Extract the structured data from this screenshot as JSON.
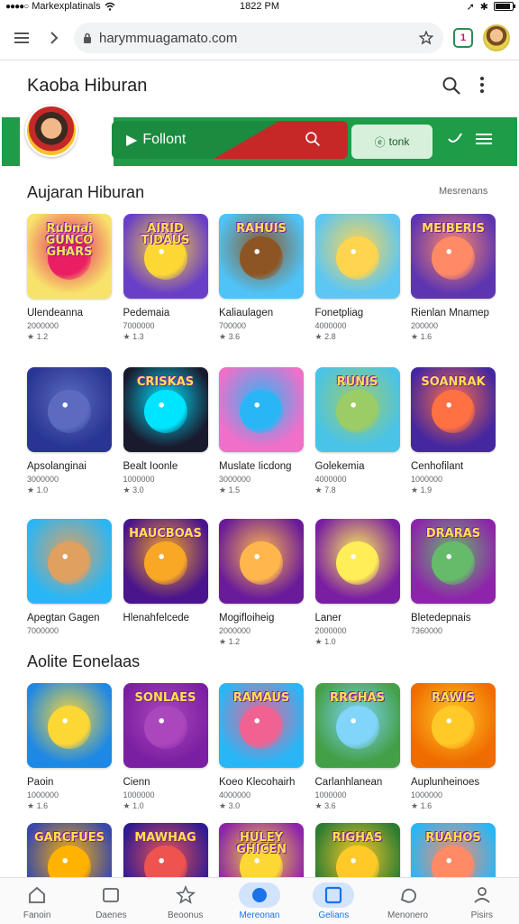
{
  "status_bar": {
    "carrier": "Markexplatinals",
    "time": "1822 PM",
    "battery_level": 0.9
  },
  "browser": {
    "url": "harymmuagamato.com",
    "tab_count": "1"
  },
  "app": {
    "title": "Kaoba Hiburan"
  },
  "banner": {
    "search_label": "Follont",
    "chip_label": "tonk"
  },
  "section1": {
    "title": "Aujaran Hiburan",
    "more": "Mesrenans",
    "rows": [
      [
        {
          "name": "Ulendeanna",
          "sub": "2000000",
          "rating": "★ 1.2",
          "art": "Rubnai GUNCO GHARS",
          "bg": "#f7e36b",
          "accent": "#e91e63"
        },
        {
          "name": "Pedemaia",
          "sub": "7000000",
          "rating": "★ 1.3",
          "art": "AIRID TIDAUS",
          "bg": "#6a3fc7",
          "accent": "#fdd835"
        },
        {
          "name": "Kaliaulagen",
          "sub": "700000",
          "rating": "★ 3.6",
          "art": "RAHUIS",
          "bg": "#4fc3f7",
          "accent": "#8d5524"
        },
        {
          "name": "Fonetpliag",
          "sub": "4000000",
          "rating": "★ 2.8",
          "art": "",
          "bg": "#5ec6f2",
          "accent": "#ffd54f"
        },
        {
          "name": "Rienlan Mnamep",
          "sub": "200000",
          "rating": "★ 1.6",
          "art": "MEIBERIS",
          "bg": "#5e35b1",
          "accent": "#ff8a65"
        }
      ],
      [
        {
          "name": "Apsolanginai",
          "sub": "3000000",
          "rating": "★ 1.0",
          "art": "",
          "bg": "#283593",
          "accent": "#5c6bc0"
        },
        {
          "name": "Bealt Ioonle",
          "sub": "1000000",
          "rating": "★ 3.0",
          "art": "CRISKAS",
          "bg": "#1a1a2e",
          "accent": "#00e5ff"
        },
        {
          "name": "Muslate Iicdong",
          "sub": "3000000",
          "rating": "★ 1.5",
          "art": "",
          "bg": "#f06fc9",
          "accent": "#29b6f6"
        },
        {
          "name": "Golekemia",
          "sub": "4000000",
          "rating": "★ 7.8",
          "art": "RUNIS",
          "bg": "#4ac3e8",
          "accent": "#9ccc65"
        },
        {
          "name": "Cenhofilant",
          "sub": "1000000",
          "rating": "★ 1.9",
          "art": "SOANRAK",
          "bg": "#4527a0",
          "accent": "#ff7043"
        }
      ],
      [
        {
          "name": "Apegtan Gagen",
          "sub": "7000000",
          "rating": "",
          "art": "",
          "bg": "#29b6f6",
          "accent": "#e0a060"
        },
        {
          "name": "Hlenahfelcede",
          "sub": "",
          "rating": "",
          "art": "HAUCBOAS",
          "bg": "#4a148c",
          "accent": "#f9a825"
        },
        {
          "name": "Mogifloiheig",
          "sub": "2000000",
          "rating": "★ 1.2",
          "art": "",
          "bg": "#6a1b9a",
          "accent": "#ffb74d"
        },
        {
          "name": "Laner",
          "sub": "2000000",
          "rating": "★ 1.0",
          "art": "",
          "bg": "#7b1fa2",
          "accent": "#ffee58"
        },
        {
          "name": "Bletedepnais",
          "sub": "7360000",
          "rating": "",
          "art": "DRARAS",
          "bg": "#8e24aa",
          "accent": "#66bb6a"
        }
      ]
    ]
  },
  "section2": {
    "title": "Aolite Eonelaas",
    "rows": [
      [
        {
          "name": "Paoin",
          "sub": "1000000",
          "rating": "★ 1.6",
          "art": "",
          "bg": "#1e88e5",
          "accent": "#fdd835"
        },
        {
          "name": "Cienn",
          "sub": "1000000",
          "rating": "★ 1.0",
          "art": "SONLAES",
          "bg": "#7b1fa2",
          "accent": "#ab47bc"
        },
        {
          "name": "Koeo Klecohairh",
          "sub": "4000000",
          "rating": "★ 3.0",
          "art": "RAMAUS",
          "bg": "#29b6f6",
          "accent": "#f06292"
        },
        {
          "name": "Carlanhlanean",
          "sub": "1000000",
          "rating": "★ 3.6",
          "art": "RRGHAS",
          "bg": "#43a047",
          "accent": "#81d4fa"
        },
        {
          "name": "Auplunheinoes",
          "sub": "1000000",
          "rating": "★ 1.6",
          "art": "RAWIS",
          "bg": "#ef6c00",
          "accent": "#ffca28"
        }
      ],
      [
        {
          "name": "",
          "sub": "",
          "rating": "",
          "art": "GARCFUES",
          "bg": "#3949ab",
          "accent": "#ffb300"
        },
        {
          "name": "",
          "sub": "",
          "rating": "",
          "art": "MAWHAG",
          "bg": "#311b92",
          "accent": "#ef5350"
        },
        {
          "name": "",
          "sub": "",
          "rating": "",
          "art": "HULEY GHICEN",
          "bg": "#8e24aa",
          "accent": "#fdd835"
        },
        {
          "name": "",
          "sub": "",
          "rating": "",
          "art": "RIGHAS",
          "bg": "#2e7d32",
          "accent": "#ffca28"
        },
        {
          "name": "",
          "sub": "",
          "rating": "",
          "art": "RUAHOS",
          "bg": "#29b6f6",
          "accent": "#ff8a65"
        }
      ]
    ]
  },
  "bottom_nav": [
    {
      "label": "Fanoin",
      "icon": "home-icon",
      "active": false
    },
    {
      "label": "Daenes",
      "icon": "library-icon",
      "active": false
    },
    {
      "label": "Beoonus",
      "icon": "star-icon",
      "active": false
    },
    {
      "label": "Mereonan",
      "icon": "profile-icon",
      "active": true
    },
    {
      "label": "Gelians",
      "icon": "games-icon",
      "active": true
    },
    {
      "label": "Menonero",
      "icon": "chat-icon",
      "active": false
    },
    {
      "label": "Pisirs",
      "icon": "account-icon",
      "active": false
    }
  ]
}
